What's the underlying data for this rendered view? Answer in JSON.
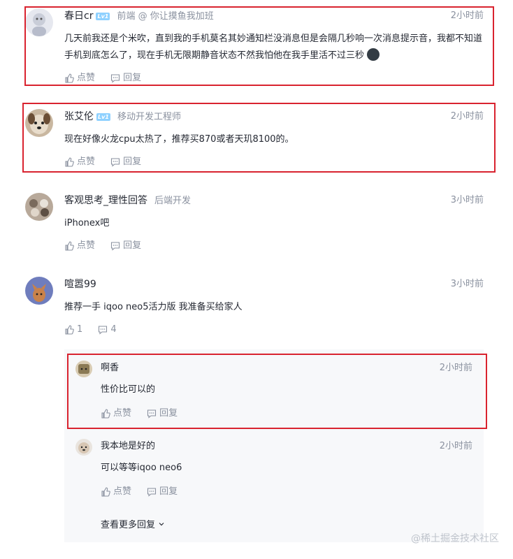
{
  "comments": [
    {
      "name": "春日cr",
      "level": "Lv1",
      "title": "前端 @ 你让摸鱼我加班",
      "time": "2小时前",
      "content": "几天前我还是个米吹，直到我的手机莫名其妙通知栏没消息但是会隔几秒响一次消息提示音，我都不知道手机到底怎么了，现在手机无限期静音状态不然我怕他在我手里活不过三秒",
      "like": "点赞",
      "reply": "回复"
    },
    {
      "name": "张艾伦",
      "level": "Lv1",
      "title": "移动开发工程师",
      "time": "2小时前",
      "content": "现在好像火龙cpu太热了，推荐买870或者天玑8100的。",
      "like": "点赞",
      "reply": "回复"
    },
    {
      "name": "客观思考_理性回答",
      "title": "后端开发",
      "time": "3小时前",
      "content": "iPhonex吧",
      "like": "点赞",
      "reply": "回复"
    },
    {
      "name": "喧嚣99",
      "time": "3小时前",
      "content": "推荐一手 iqoo neo5活力版 我准备买给家人",
      "like": "1",
      "reply": "4"
    }
  ],
  "replies": [
    {
      "name": "啊香",
      "time": "2小时前",
      "content": "性价比可以的",
      "like": "点赞",
      "reply": "回复"
    },
    {
      "name": "我本地是好的",
      "time": "2小时前",
      "content": "可以等等iqoo neo6",
      "like": "点赞",
      "reply": "回复"
    }
  ],
  "more_replies": "查看更多回复",
  "watermark": "@稀土掘金技术社区",
  "colors": {
    "highlight_border": "#d9232f",
    "level_badge": "#8fd1ff"
  }
}
